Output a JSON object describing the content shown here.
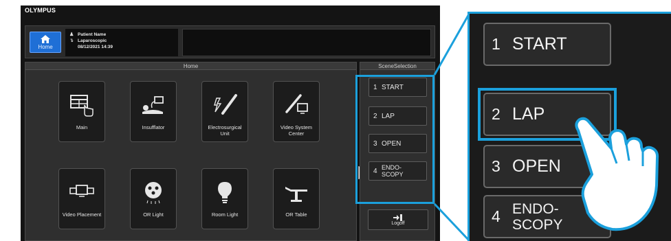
{
  "brand": "OLYMPUS",
  "header": {
    "home_label": "Home",
    "patient_name": "Patient Name",
    "procedure": "Laparoscopic",
    "datetime": "08/12/2021   14:39"
  },
  "home_panel": {
    "title": "Home",
    "tiles": [
      {
        "label": "Main",
        "icon": "window-grid-hand-icon"
      },
      {
        "label": "Insufflator",
        "icon": "insufflator-icon"
      },
      {
        "label": "Electrosurgical Unit",
        "icon": "electrosurgical-icon"
      },
      {
        "label": "Video System Center",
        "icon": "video-system-icon"
      },
      {
        "label": "Video Placement",
        "icon": "video-placement-icon"
      },
      {
        "label": "OR Light",
        "icon": "or-light-icon"
      },
      {
        "label": "Room Light",
        "icon": "lightbulb-icon"
      },
      {
        "label": "OR Table",
        "icon": "or-table-icon"
      }
    ]
  },
  "scene_panel": {
    "title": "SceneSelection",
    "buttons": [
      {
        "num": "1",
        "label": "START"
      },
      {
        "num": "2",
        "label": "LAP"
      },
      {
        "num": "3",
        "label": "OPEN"
      },
      {
        "num": "4",
        "label": "ENDO-",
        "label2": "SCOPY"
      }
    ],
    "logoff_label": "Logoff"
  },
  "zoom": {
    "buttons": [
      {
        "num": "1",
        "label": "START"
      },
      {
        "num": "2",
        "label": "LAP"
      },
      {
        "num": "3",
        "label": "OPEN"
      },
      {
        "num": "4",
        "label": "ENDO-",
        "label2": "SCOPY"
      }
    ],
    "highlighted": "2"
  },
  "side_code": "124621",
  "colors": {
    "accent": "#1ba0dc",
    "home_button": "#1f6fd6",
    "screen_bg": "#141414",
    "panel_bg": "#2f2f2f"
  }
}
